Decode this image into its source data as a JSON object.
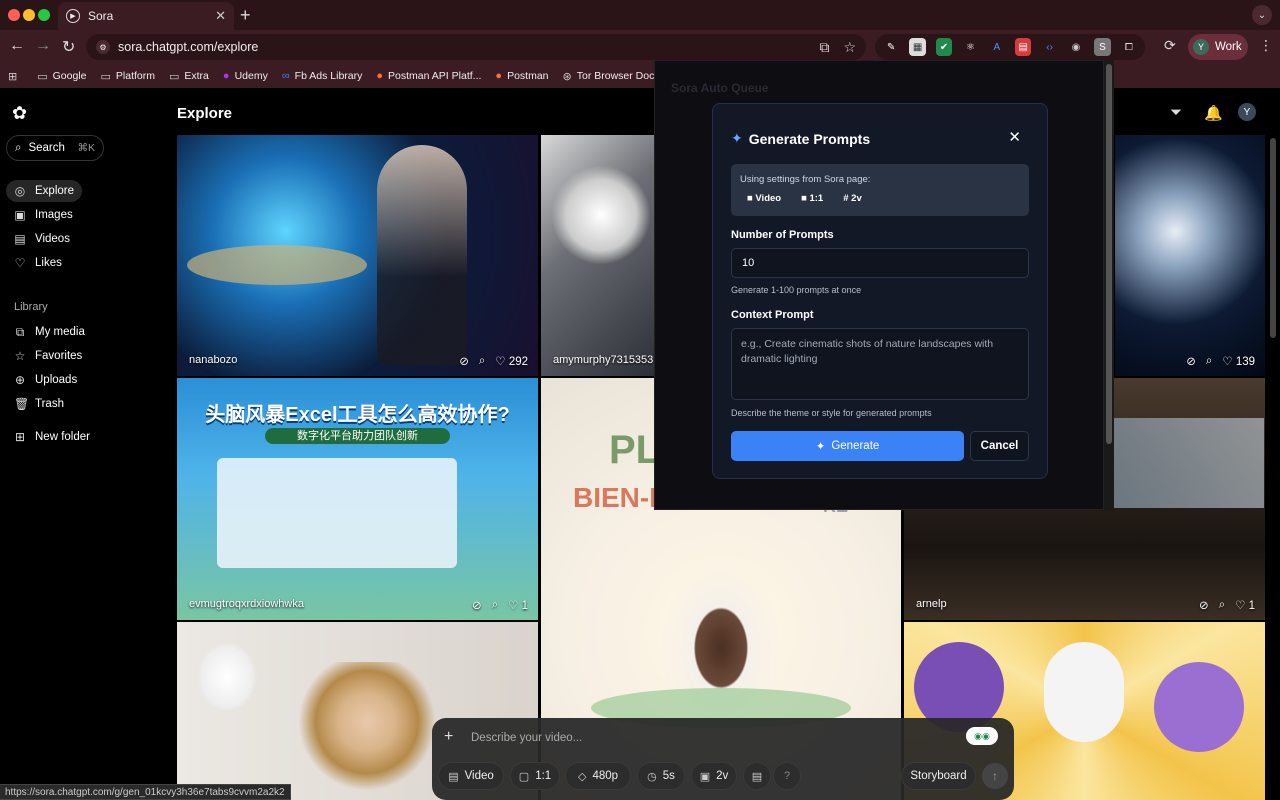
{
  "browser": {
    "tab_title": "Sora",
    "url": "sora.chatgpt.com/explore",
    "profile_label": "Work",
    "profile_initial": "Y",
    "bookmarks": [
      "Google",
      "Platform",
      "Extra",
      "Udemy",
      "Fb Ads Library",
      "Postman API Platf...",
      "Postman",
      "Tor Browser Docs"
    ],
    "status_url": "https://sora.chatgpt.com/g/gen_01kcvy3h36e7tabs9cvvm2a2k2"
  },
  "sidebar": {
    "search_label": "Search",
    "search_shortcut": "⌘K",
    "nav": [
      "Explore",
      "Images",
      "Videos",
      "Likes"
    ],
    "library_label": "Library",
    "library": [
      "My media",
      "Favorites",
      "Uploads",
      "Trash"
    ],
    "new_folder": "New folder"
  },
  "main": {
    "title": "Explore",
    "user_initial": "Y",
    "cards": [
      {
        "user": "nanabozo",
        "likes": "292"
      },
      {
        "user": "amymurphy7315353",
        "likes": ""
      },
      {
        "user": "",
        "likes": "139"
      },
      {
        "user": "evmugtroqxrdxiowhwka",
        "likes": "1",
        "text1": "头脑风暴Excel工具怎么高效协作?",
        "text2": "数字化平台助力团队创新"
      },
      {
        "user": "",
        "likes": "",
        "text1": "PL",
        "text2": "BIEN-Ê",
        "text3": "RE"
      },
      {
        "user": "arnelp",
        "likes": "1"
      },
      {
        "user": "",
        "likes": ""
      },
      {
        "user": "",
        "likes": ""
      }
    ]
  },
  "composer": {
    "placeholder": "Describe your video...",
    "type": "Video",
    "aspect": "1:1",
    "resolution": "480p",
    "duration": "5s",
    "variations": "2v",
    "help": "?",
    "storyboard": "Storyboard"
  },
  "extension": {
    "bg_title": "Sora Auto Queue",
    "modal": {
      "title": "Generate Prompts",
      "settings_label": "Using settings from Sora page:",
      "chip_type": "Video",
      "chip_aspect": "1:1",
      "chip_variations": "2v",
      "num_label": "Number of Prompts",
      "num_value": "10",
      "num_help": "Generate 1-100 prompts at once",
      "ctx_label": "Context Prompt",
      "ctx_placeholder": "e.g., Create cinematic shots of nature landscapes with dramatic lighting",
      "ctx_help": "Describe the theme or style for generated prompts",
      "generate": "Generate",
      "cancel": "Cancel"
    }
  },
  "colors": {
    "accent_blue": "#3b82f6",
    "chrome_bg": "#3a1c22",
    "profile_bg": "#6b2e3a"
  }
}
